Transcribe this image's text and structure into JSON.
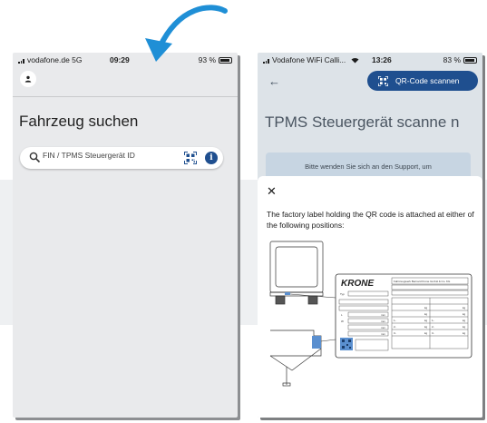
{
  "left_phone": {
    "status": {
      "carrier": "vodafone.de 5G",
      "time": "09:29",
      "battery": "93 %"
    },
    "title": "Fahrzeug suchen",
    "search": {
      "placeholder": "FIN / TPMS Steuergerät ID"
    },
    "icons": {
      "avatar": "person-icon",
      "search": "search-icon",
      "qr": "qr-code-icon",
      "info": "info-icon"
    }
  },
  "right_phone": {
    "status": {
      "carrier": "Vodafone WiFi Calli...",
      "time": "13:26",
      "battery": "83 %"
    },
    "qr_button_label": "QR-Code scannen",
    "title": "TPMS Steuergerät scanne n",
    "support_text": "Bitte wenden Sie sich an den Support, um",
    "sheet": {
      "close_label": "✕",
      "description": "The factory label holding the QR code is attached at either of the following positions:"
    },
    "plate": {
      "brand": "KRONE",
      "manufacturer_line": "Fahrzeugwerk Bernard Krone GmbH & Co. KG",
      "type_label": "Typ",
      "unit_labels": [
        "mm",
        "mm",
        "mm",
        "mm"
      ],
      "weight_unit": "kg",
      "row_labels": [
        "L",
        "W",
        "1-",
        "2-",
        "3-"
      ]
    }
  },
  "colors": {
    "accent": "#1f4f8f",
    "arrow": "#1f8fd6"
  }
}
